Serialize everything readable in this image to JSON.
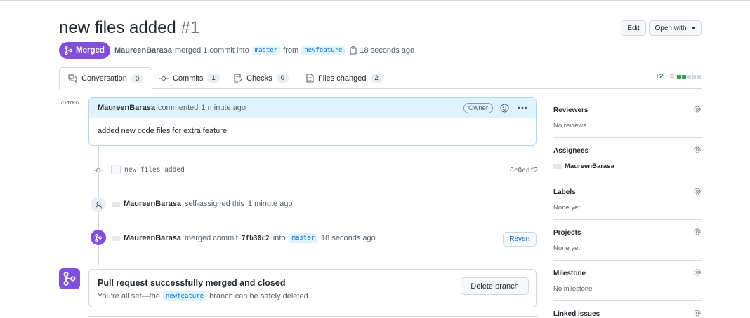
{
  "pr": {
    "title": "new files added",
    "number": "#1",
    "status": "Merged",
    "author": "MaureenBarasa",
    "meta_text": "merged 1 commit into",
    "base_branch": "master",
    "from_text": "from",
    "head_branch": "newfeature",
    "time": "18 seconds ago"
  },
  "header_buttons": {
    "edit": "Edit",
    "open_with": "Open with"
  },
  "tabs": [
    {
      "label": "Conversation",
      "count": "0"
    },
    {
      "label": "Commits",
      "count": "1"
    },
    {
      "label": "Checks",
      "count": "0"
    },
    {
      "label": "Files changed",
      "count": "2"
    }
  ],
  "diffstat": {
    "additions": "+2",
    "deletions": "−0"
  },
  "comment": {
    "author": "MaureenBarasa",
    "action": "commented",
    "time": "1 minute ago",
    "badge": "Owner",
    "body": "added new code files for extra feature",
    "avatar_text": "CLOUD"
  },
  "commit_event": {
    "message": "new files added",
    "sha": "0c0edf2"
  },
  "assign_event": {
    "user": "MaureenBarasa",
    "text": "self-assigned this",
    "time": "1 minute ago"
  },
  "merge_event": {
    "user": "MaureenBarasa",
    "text": "merged commit",
    "sha": "7fb30c2",
    "into": "into",
    "branch": "master",
    "time": "18 seconds ago",
    "revert": "Revert"
  },
  "merge_box": {
    "title": "Pull request successfully merged and closed",
    "text_before": "You’re all set—the",
    "branch": "newfeature",
    "text_after": "branch can be safely deleted.",
    "button": "Delete branch"
  },
  "sidebar": {
    "reviewers": {
      "label": "Reviewers",
      "value": "No reviews"
    },
    "assignees": {
      "label": "Assignees",
      "value": "MaureenBarasa"
    },
    "labels": {
      "label": "Labels",
      "value": "None yet"
    },
    "projects": {
      "label": "Projects",
      "value": "None yet"
    },
    "milestone": {
      "label": "Milestone",
      "value": "No milestone"
    },
    "linked_issues": {
      "label": "Linked issues"
    }
  },
  "colors": {
    "merged": "#8250df",
    "link": "#0969da",
    "additions": "#1a7f37",
    "deletions": "#cf222e"
  }
}
